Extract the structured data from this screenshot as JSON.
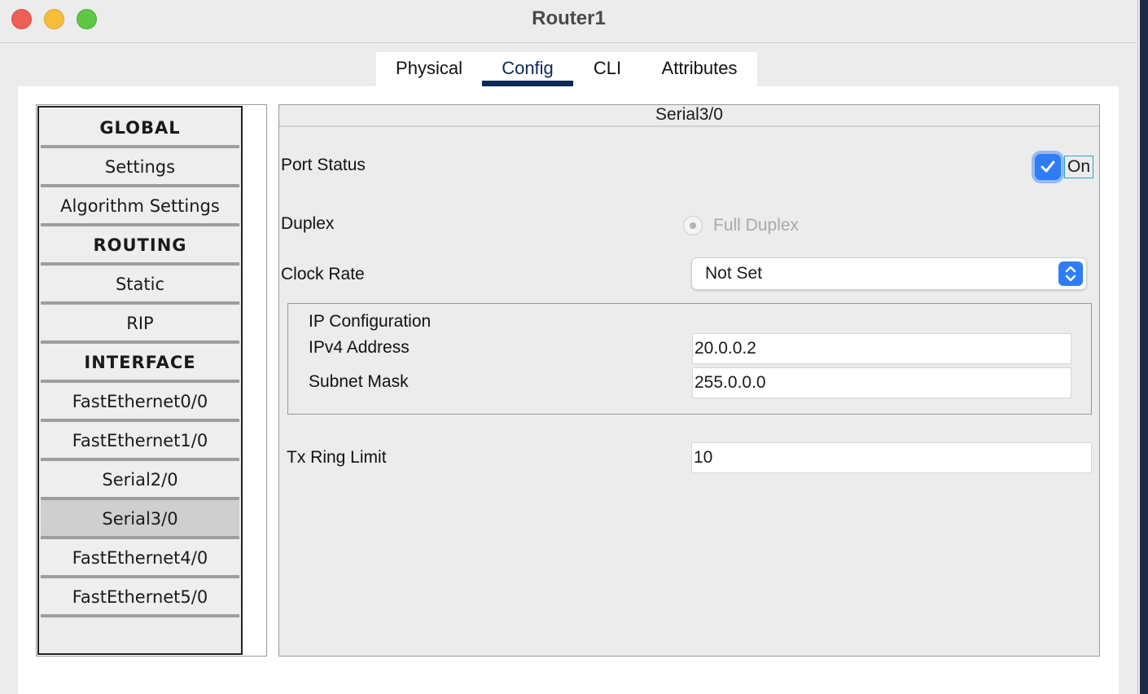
{
  "window": {
    "title": "Router1"
  },
  "tabs": [
    {
      "label": "Physical"
    },
    {
      "label": "Config"
    },
    {
      "label": "CLI"
    },
    {
      "label": "Attributes"
    }
  ],
  "sidebar": {
    "items": [
      {
        "label": "GLOBAL",
        "header": true
      },
      {
        "label": "Settings"
      },
      {
        "label": "Algorithm Settings"
      },
      {
        "label": "ROUTING",
        "header": true
      },
      {
        "label": "Static"
      },
      {
        "label": "RIP"
      },
      {
        "label": "INTERFACE",
        "header": true
      },
      {
        "label": "FastEthernet0/0"
      },
      {
        "label": "FastEthernet1/0"
      },
      {
        "label": "Serial2/0"
      },
      {
        "label": "Serial3/0",
        "selected": true
      },
      {
        "label": "FastEthernet4/0"
      },
      {
        "label": "FastEthernet5/0"
      }
    ]
  },
  "panel": {
    "title": "Serial3/0",
    "port_status": {
      "label": "Port Status",
      "checked": true,
      "checkbox_label": "On"
    },
    "duplex": {
      "label": "Duplex",
      "option": "Full Duplex",
      "disabled": true
    },
    "clock_rate": {
      "label": "Clock Rate",
      "value": "Not Set"
    },
    "ip_config": {
      "title": "IP Configuration",
      "ipv4_label": "IPv4 Address",
      "ipv4_value": "20.0.0.2",
      "mask_label": "Subnet Mask",
      "mask_value": "255.0.0.0"
    },
    "tx_ring": {
      "label": "Tx Ring Limit",
      "value": "10"
    }
  },
  "colors": {
    "accent": "#2f7df6",
    "tab_underline": "#0b2a55",
    "close": "#ee5f57",
    "minimize": "#f6bd3a",
    "maximize": "#5ec745"
  }
}
